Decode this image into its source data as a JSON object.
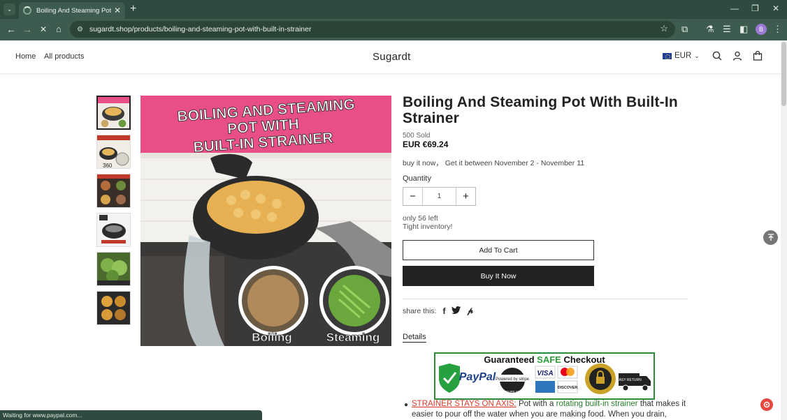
{
  "browser": {
    "tab_title": "Boiling And Steaming Pot With Built-In Strainer",
    "url": "sugardt.shop/products/boiling-and-steaming-pot-with-built-in-strainer",
    "profile_initial": "B",
    "status_text": "Waiting for www.paypal.com..."
  },
  "header": {
    "nav": [
      "Home",
      "All products"
    ],
    "brand": "Sugardt",
    "currency": "EUR"
  },
  "product": {
    "title": "Boiling And Steaming Pot With Built-In Strainer",
    "sold": "500 Sold",
    "price": "EUR €69.24",
    "delivery": "buy it now，  Get it between November 2 - November 11",
    "quantity_label": "Quantity",
    "quantity": "1",
    "stock_line1": "only 56 left",
    "stock_line2": "Tight inventory!",
    "add_to_cart": "Add To Cart",
    "buy_now": "Buy It Now",
    "share_label": "share this:",
    "details_tab": "Details"
  },
  "image": {
    "headline_1": "BOILING AND STEAMING",
    "headline_2": "POT WITH",
    "headline_3": "BUILT-IN STRAINER",
    "label_left": "Boiling",
    "label_right": "Steaming",
    "thumb_360": "360"
  },
  "badge": {
    "title_pre": "Guaranteed ",
    "title_safe": "SAFE",
    "title_post": " Checkout",
    "paypal": "PayPal",
    "stripe": "Powered by stripe",
    "secure": "SECURE SITE",
    "visa": "VISA",
    "discover": "DISCOVER",
    "easy": "EASY RETURN"
  },
  "feature": {
    "heading": "STRAINER STAYS ON AXIS:",
    "text_a": " Pot with a ",
    "highlight": "rotating built-in strainer",
    "text_b": " that makes it easier to pour off the water when you are making food. When you drain,"
  },
  "colors": {
    "chrome": "#3d5b4e",
    "tabbar": "#2f4b3f",
    "image_banner": "#e84f86",
    "buy_button": "#222222",
    "badge_border": "#2e8b3a"
  }
}
